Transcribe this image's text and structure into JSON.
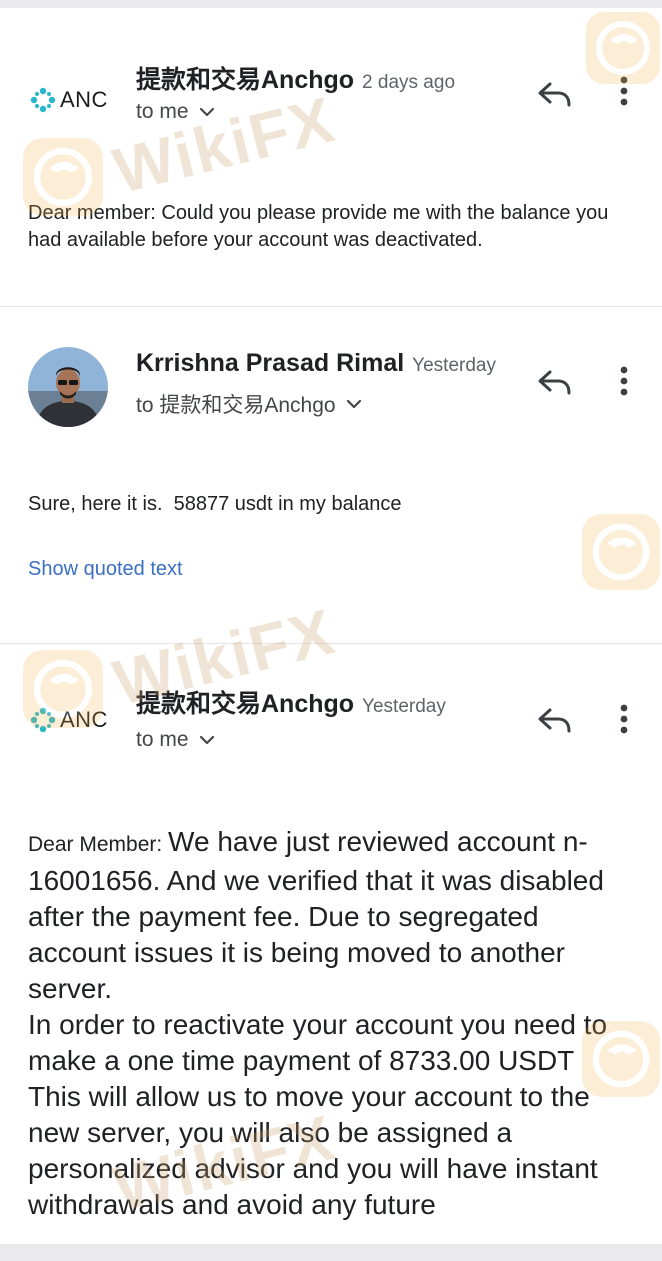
{
  "messages": [
    {
      "sender": "提款和交易Anchgo",
      "time": "2 days ago",
      "recipient": "to me",
      "avatar_label": "ANC",
      "body": "Dear member: Could you please provide me with the balance you had available before your account was deactivated."
    },
    {
      "sender": "Krrishna Prasad Rimal",
      "time": "Yesterday",
      "recipient": "to 提款和交易Anchgo",
      "body": "Sure, here it is.  58877 usdt in my balance",
      "quoted_link": "Show quoted text"
    },
    {
      "sender": "提款和交易Anchgo",
      "time": "Yesterday",
      "recipient": "to me",
      "avatar_label": "ANC",
      "body_lead": "Dear Member: ",
      "body_lines": [
        "We have just reviewed account n-16001656. And we verified that it was disabled after the payment fee. Due to segregated account issues it is being moved to another server.",
        "In order to reactivate your account you need to make a one time payment of 8733.00 USDT",
        "This will allow us to move your account to the new server, you will also be assigned a personalized advisor and you will have instant withdrawals and avoid any future"
      ]
    }
  ],
  "watermark": "WikiFX",
  "icons": [
    "reply-icon",
    "more-vert-icon",
    "chevron-down-icon",
    "anc-logo-icon",
    "wikifx-eagle-watermark"
  ],
  "colors": {
    "link": "#3b6fc4",
    "logo_teal": "#29b6c9",
    "watermark": "#c9a26a"
  }
}
